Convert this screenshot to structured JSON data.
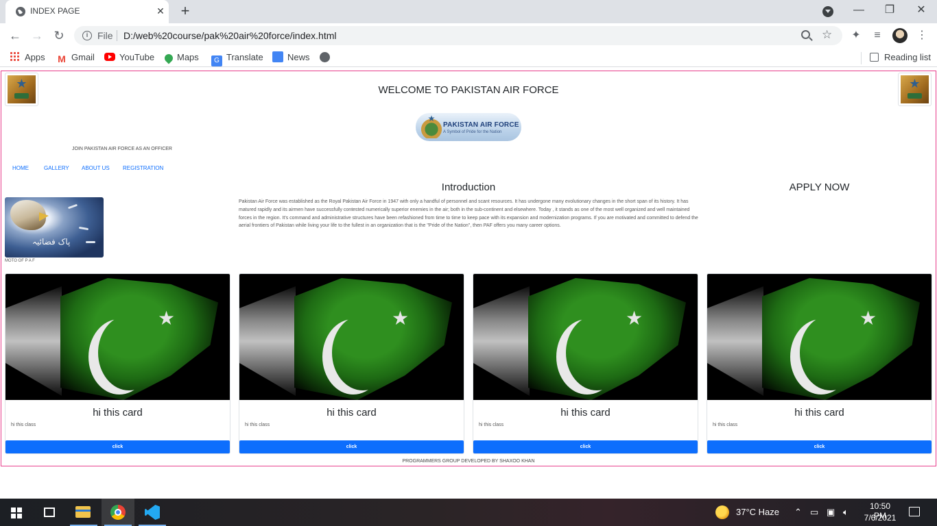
{
  "browser": {
    "tab_title": "INDEX PAGE",
    "new_tab_label": "+",
    "address": {
      "scheme_label": "File",
      "url": "D:/web%20course/pak%20air%20force/index.html"
    },
    "bookmarks": [
      {
        "label": "Apps",
        "icon": "apps-grid-icon"
      },
      {
        "label": "Gmail",
        "icon": "gmail-icon"
      },
      {
        "label": "YouTube",
        "icon": "youtube-icon"
      },
      {
        "label": "Maps",
        "icon": "maps-icon"
      },
      {
        "label": "Translate",
        "icon": "translate-icon"
      },
      {
        "label": "News",
        "icon": "news-icon"
      }
    ],
    "reading_list_label": "Reading list"
  },
  "page": {
    "heading": "WELCOME TO PAKISTAN AIR FORCE",
    "badge": {
      "name": "PAKISTAN AIR FORCE",
      "tagline": "A Symbol of Pride for the Nation"
    },
    "join_text": "JOIN PAKISTAN AIR FORCE AS AN OFFICER",
    "nav": [
      "HOME",
      "GALLERY",
      "ABOUT US",
      "REGISTRATION"
    ],
    "intro": {
      "title": "Introduction",
      "body": "Pakistan Air Force was established as the Royal Pakistan Air Force in 1947 with only a handful of personnel and scant resources. It has undergone many evolutionary changes in the short span of its history. It has matured rapidly and its airmen have successfully contested numerically superior enemies in the air; both in the sub-continent and elsewhere. Today , it stands as one of the most well organized and well maintained forces in the region. It's command and administrative structures have been refashioned from time to time to keep pace with its expansion and modernization programs. If you are motivated and committed to defend the aerial frontiers of Pakistan while living your life to the fullest in an organization that is the \"Pride of the Nation\", then PAF offers you many career options."
    },
    "apply_title": "APPLY NOW",
    "motto_image_text": "پاک فضائیہ",
    "motto_caption": "MOTO OF P A F",
    "cards": [
      {
        "title": "hi this card",
        "text": "hi this class",
        "button": "click"
      },
      {
        "title": "hi this card",
        "text": "hi this class",
        "button": "click"
      },
      {
        "title": "hi this card",
        "text": "hi this class",
        "button": "click"
      },
      {
        "title": "hi this card",
        "text": "hi this class",
        "button": "click"
      }
    ],
    "footer": "PROGRAMMERS GROUP DEVELOPED BY SHAXOO KHAN"
  },
  "taskbar": {
    "weather": "37°C  Haze",
    "time": "10:50 PM",
    "date": "7/6/2021"
  },
  "colors": {
    "accent_button": "#0d6efd",
    "page_border": "#e83e8c",
    "nav_link": "#0d6efd"
  }
}
